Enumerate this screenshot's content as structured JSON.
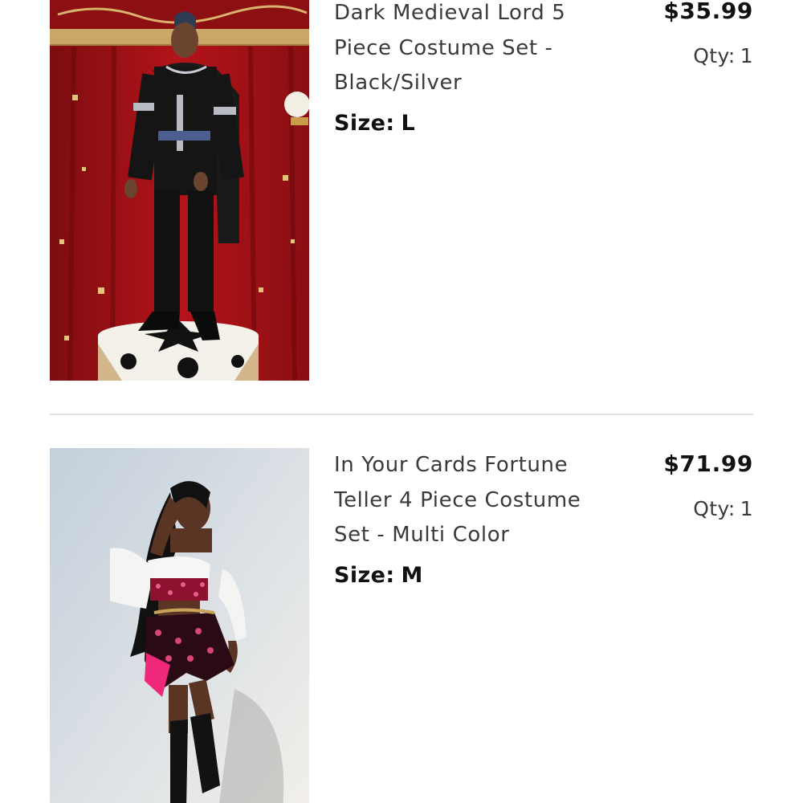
{
  "cart": {
    "items": [
      {
        "title": "Dark Medieval Lord 5 Piece Costume Set - Black/Silver",
        "title_lines": [
          "Dark Medieval Lord 5",
          "Piece Costume Set -",
          "Black/Silver"
        ],
        "size_label": "Size:",
        "size_value": "L",
        "price": "$35.99",
        "qty_label": "Qty:",
        "qty_value": "1",
        "image_icon": "product-photo-medieval-lord"
      },
      {
        "title": "In Your Cards Fortune Teller 4 Piece Costume Set - Multi Color",
        "title_lines": [
          "In Your Cards Fortune",
          "Teller 4 Piece Costume",
          "Set - Multi Color"
        ],
        "size_label": "Size:",
        "size_value": "M",
        "price": "$71.99",
        "qty_label": "Qty:",
        "qty_value": "1",
        "image_icon": "product-photo-fortune-teller"
      }
    ]
  },
  "colors": {
    "text_primary": "#111111",
    "text_secondary": "#3a3a3a",
    "divider": "#e2e2e2",
    "background": "#ffffff"
  }
}
